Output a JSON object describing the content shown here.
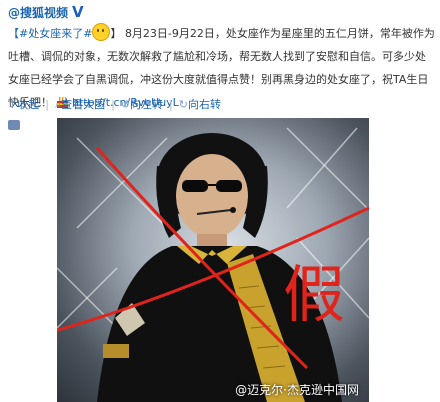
{
  "header": {
    "account": "@搜狐视频"
  },
  "post": {
    "hashtag": "【#处女座来了#",
    "close_bracket": "】",
    "text": "8月23日-9月22日，处女座作为星座里的五仁月饼，常年被作为吐槽、调侃的对象，无数次解救了尴尬和冷场，帮无数人找到了安慰和自信。可多少处女座已经学会了自黑调侃，冲这份大度就值得点赞！别再黑身边的处女座了，祝TA生日快乐吧！",
    "link": "http://t.cn/RveUuyL"
  },
  "toolbar": {
    "collapse": "收起",
    "view_large": "查看大图",
    "rotate_left": "向左转",
    "rotate_right": "向右转"
  },
  "image": {
    "annotation": "假",
    "watermark": "@迈克尔·杰克逊中国网"
  },
  "colors": {
    "link": "#1a64b2",
    "annotation": "#e0241c"
  }
}
